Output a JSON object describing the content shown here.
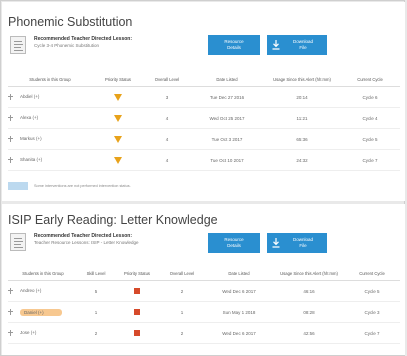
{
  "section1": {
    "title": "Phonemic Substitution",
    "lesson_title": "Recommended Teacher Directed Lesson:",
    "lesson_subtitle": "Cycle 3-4 Phonemic Substitution",
    "btn_details": [
      "Resource",
      "Details"
    ],
    "btn_download": [
      "Download",
      "File"
    ],
    "columns": [
      "Students in this Group",
      "Priority Status",
      "Overall Level",
      "Date Listed",
      "Usage Since this Alert (hh:mm)",
      "Current Cycle"
    ],
    "rows": [
      {
        "student": "Abdiel (+)",
        "level": "3",
        "date": "Tue Dec 27 2016",
        "usage": "20:14",
        "cycle": "Cycle 6"
      },
      {
        "student": "Alexa (+)",
        "level": "4",
        "date": "Wed Oct 25 2017",
        "usage": "11:21",
        "cycle": "Cycle 4"
      },
      {
        "student": "Markus (+)",
        "level": "4",
        "date": "Tue Oct 3 2017",
        "usage": "65:36",
        "cycle": "Cycle 5"
      },
      {
        "student": "Shanita (+)",
        "level": "4",
        "date": "Tue Oct 10 2017",
        "usage": "24:32",
        "cycle": "Cycle 7"
      }
    ],
    "note": "Some interventions are not performed intervention status."
  },
  "section2": {
    "title": "ISIP Early Reading: Letter Knowledge",
    "lesson_title": "Recommended Teacher Directed Lesson:",
    "lesson_subtitle": "Teacher Resource Lessons: ISIP - Letter Knowledge",
    "btn_details": [
      "Resource",
      "Details"
    ],
    "btn_download": [
      "Download",
      "File"
    ],
    "columns": [
      "Students in this Group",
      "Skill Level",
      "Priority Status",
      "Overall Level",
      "Date Listed",
      "Usage Since this Alert (hh:mm)",
      "Current Cycle"
    ],
    "rows": [
      {
        "student": "Andreo (+)",
        "skill": "5",
        "level": "2",
        "date": "Wed Dec 6 2017",
        "usage": "46:16",
        "cycle": "Cycle 5"
      },
      {
        "student": "Daniel (+)",
        "skill": "1",
        "level": "1",
        "date": "Sun May 1 2018",
        "usage": "08:28",
        "cycle": "Cycle 3"
      },
      {
        "student": "Jose (+)",
        "skill": "2",
        "level": "2",
        "date": "Wed Dec 6 2017",
        "usage": "42:56",
        "cycle": "Cycle 7"
      }
    ]
  },
  "colors": {
    "accent": "#2a8fd0",
    "warning": "#e8a21a",
    "alert": "#d64a2a",
    "highlight": "#f7c890"
  }
}
